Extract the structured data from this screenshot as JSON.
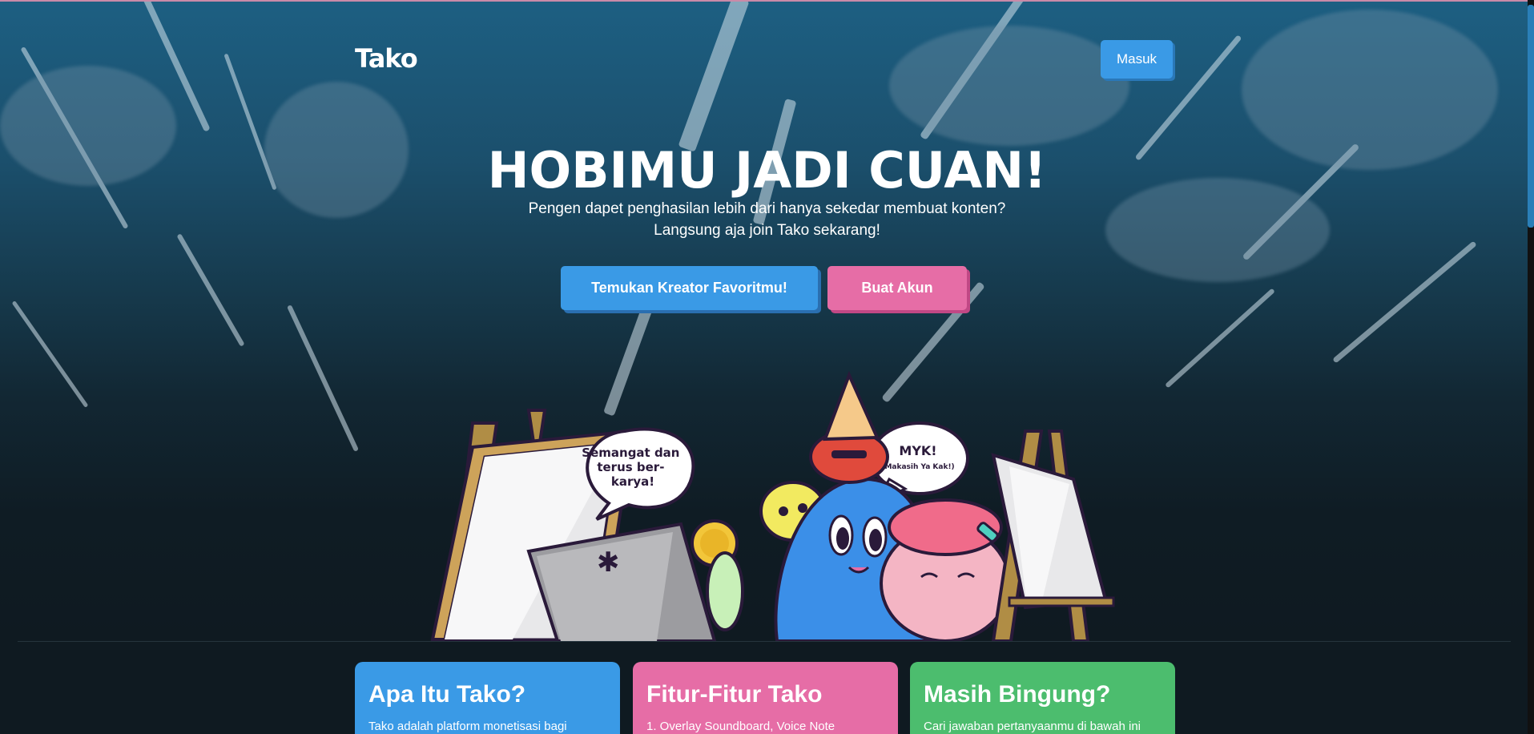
{
  "brand": {
    "logo_text": "Tako"
  },
  "header": {
    "login_label": "Masuk"
  },
  "hero": {
    "headline": "HOBIMU JADI CUAN!",
    "subtitle_line1": "Pengen dapet penghasilan lebih dari hanya sekedar membuat konten?",
    "subtitle_line2": "Langsung aja join Tako sekarang!",
    "cta_primary": "Temukan Kreator Favoritmu!",
    "cta_secondary": "Buat Akun"
  },
  "illustration": {
    "bubble_left": "Semangat dan terus ber-karya!",
    "bubble_right_main": "MYK!",
    "bubble_right_sub": "(Makasih Ya Kak!)"
  },
  "cards": [
    {
      "title": "Apa Itu Tako?",
      "text": "Tako adalah platform monetisasi bagi"
    },
    {
      "title": "Fitur-Fitur Tako",
      "text": "1. Overlay Soundboard, Voice Note"
    },
    {
      "title": "Masih Bingung?",
      "text": "Cari jawaban pertanyaanmu di bawah ini"
    }
  ],
  "colors": {
    "blue": "#3a9ae6",
    "pink": "#e66da6",
    "green": "#4cbd6e",
    "background": "#0f1a21"
  }
}
